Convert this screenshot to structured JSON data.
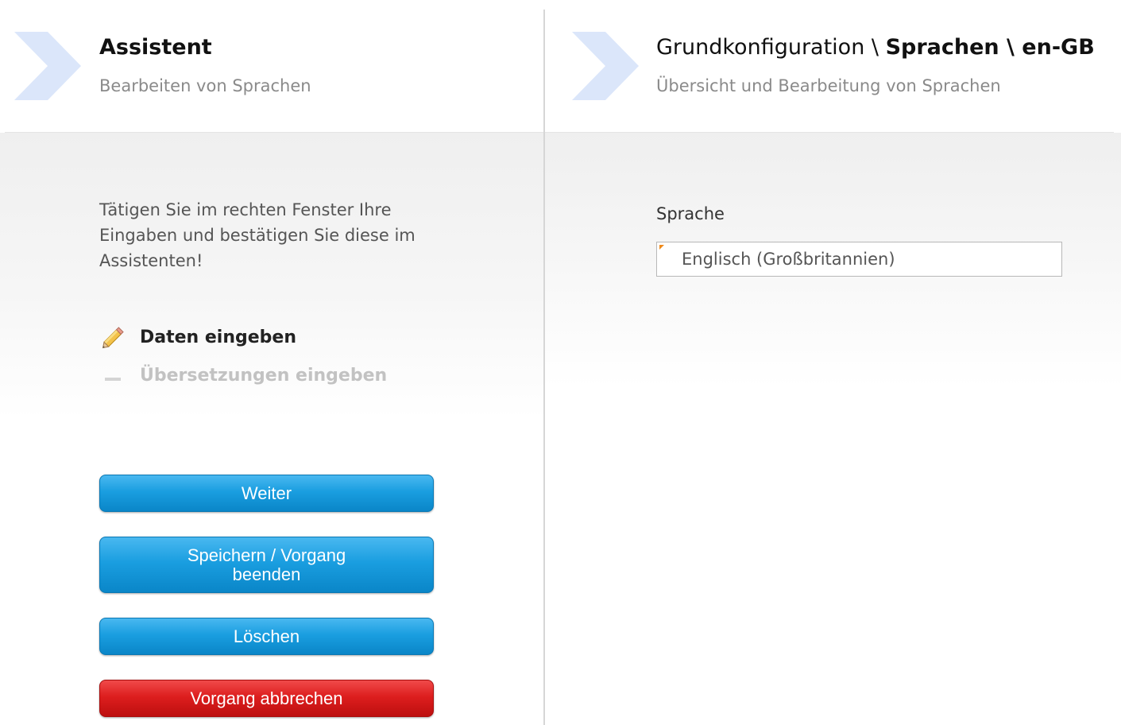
{
  "assistant": {
    "title": "Assistent",
    "subtitle": "Bearbeiten von Sprachen",
    "instructions": "Tätigen Sie im rechten Fenster Ihre Eingaben und bestätigen Sie diese im Assistenten!",
    "steps": [
      {
        "label": "Daten eingeben",
        "state": "active",
        "icon": "pencil-icon"
      },
      {
        "label": "Übersetzungen eingeben",
        "state": "inactive",
        "icon": "dash-icon"
      }
    ],
    "buttons": {
      "next": "Weiter",
      "save_finish": "Speichern / Vorgang beenden",
      "delete": "Löschen",
      "cancel": "Vorgang abbrechen"
    }
  },
  "content": {
    "breadcrumb_prefix": "Grundkonfiguration \\ ",
    "breadcrumb_bold": "Sprachen \\ en-GB",
    "subtitle": "Übersicht und Bearbeitung von Sprachen",
    "field": {
      "label": "Sprache",
      "value": "Englisch (Großbritannien)",
      "required": true
    }
  },
  "colors": {
    "primary_button": "#1a9ee0",
    "danger_button": "#dd1e1e",
    "chevron": "#dbe6fa",
    "required_marker": "#f08a1a"
  }
}
